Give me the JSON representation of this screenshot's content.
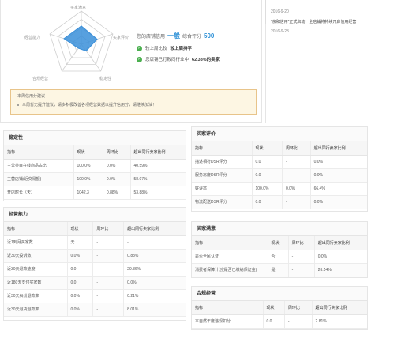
{
  "radar": {
    "axes": [
      "买家满意",
      "买家评价",
      "稳定性",
      "合规经营",
      "经营能力"
    ],
    "values": [
      0.55,
      0.5,
      0.25,
      0.15,
      0.55
    ],
    "fill_color": "#3a8fd9",
    "grid_color": "#cfcfcf"
  },
  "summary": {
    "prefix": "您的店铺信用",
    "level": "一般",
    "score_label": "综合评分",
    "score": "500",
    "checks": [
      {
        "text": "较上周比较",
        "bold": "较上周持平"
      },
      {
        "text": "您店铺已打败同行业中",
        "bold": "62.33%的卖家"
      }
    ]
  },
  "notice": {
    "title": "本周信用分建议",
    "text": "本周暂无提升建议，请多积极改善各项经营数据以提升信用分，请继续加油！"
  },
  "timeline": [
    {
      "date": "2016-9-20",
      "text": ""
    },
    {
      "date": "",
      "text": "“亲和信用”正式启动，全店铺将持续开启信用经营"
    },
    {
      "date": "2016-9-23",
      "text": ""
    }
  ],
  "stability": {
    "title": "稳定性",
    "headers": [
      "指标",
      "现状",
      "周环比",
      "超出同行卖家比例"
    ],
    "rows": [
      [
        "主营类目在线商品占比",
        "100.0%",
        "0.0%",
        "40.59%"
      ],
      [
        "主营店铺(近交易额)",
        "100.0%",
        "0.0%",
        "58.07%"
      ],
      [
        "开店时长（天）",
        "1042.3",
        "0.88%",
        "53.88%"
      ]
    ]
  },
  "buyer_review": {
    "title": "买家评价",
    "headers": [
      "指标",
      "现状",
      "周环比",
      "超出同行卖家比例"
    ],
    "rows": [
      [
        "描述相符DSR评分",
        "0.0",
        "-",
        "0.0%"
      ],
      [
        "服务态度DSR评分",
        "0.0",
        "-",
        "0.0%"
      ],
      [
        "好评率",
        "100.0%",
        "0.0%",
        "66.4%"
      ],
      [
        "物流配送DSR评分",
        "0.0",
        "-",
        "0.0%"
      ]
    ]
  },
  "operation": {
    "title": "经营能力",
    "headers": [
      "指标",
      "现状",
      "周环比",
      "超出同行卖家比例"
    ],
    "rows": [
      [
        "近1到月买家数",
        "无",
        "-",
        "-"
      ],
      [
        "近30天投诉数",
        "0.0%",
        "-",
        "0.83%"
      ],
      [
        "近30天退款速度",
        "0.0",
        "-",
        "29.36%"
      ],
      [
        "近180天支付买家数",
        "0.0",
        "-",
        "0.0%"
      ],
      [
        "近30天纠纷退款率",
        "0.0%",
        "-",
        "0.21%"
      ],
      [
        "近30天退货退款率",
        "0.0%",
        "-",
        "8.01%"
      ]
    ]
  },
  "buyer_satisfaction": {
    "title": "买家满意",
    "headers": [
      "指标",
      "现状",
      "周环比",
      "超出同行卖家比例"
    ],
    "rows": [
      [
        "是否全民认证",
        "否",
        "-",
        "0.0%"
      ],
      [
        "消费者保障计划(是否已缴纳保证金)",
        "是",
        "-",
        "26.54%"
      ]
    ]
  },
  "compliance": {
    "title": "合规经营",
    "headers": [
      "指标",
      "现状",
      "周环比",
      "超出同行卖家比例"
    ],
    "rows": [
      [
        "本自然年度违规扣分",
        "0.0",
        "-",
        "2.81%"
      ]
    ]
  }
}
